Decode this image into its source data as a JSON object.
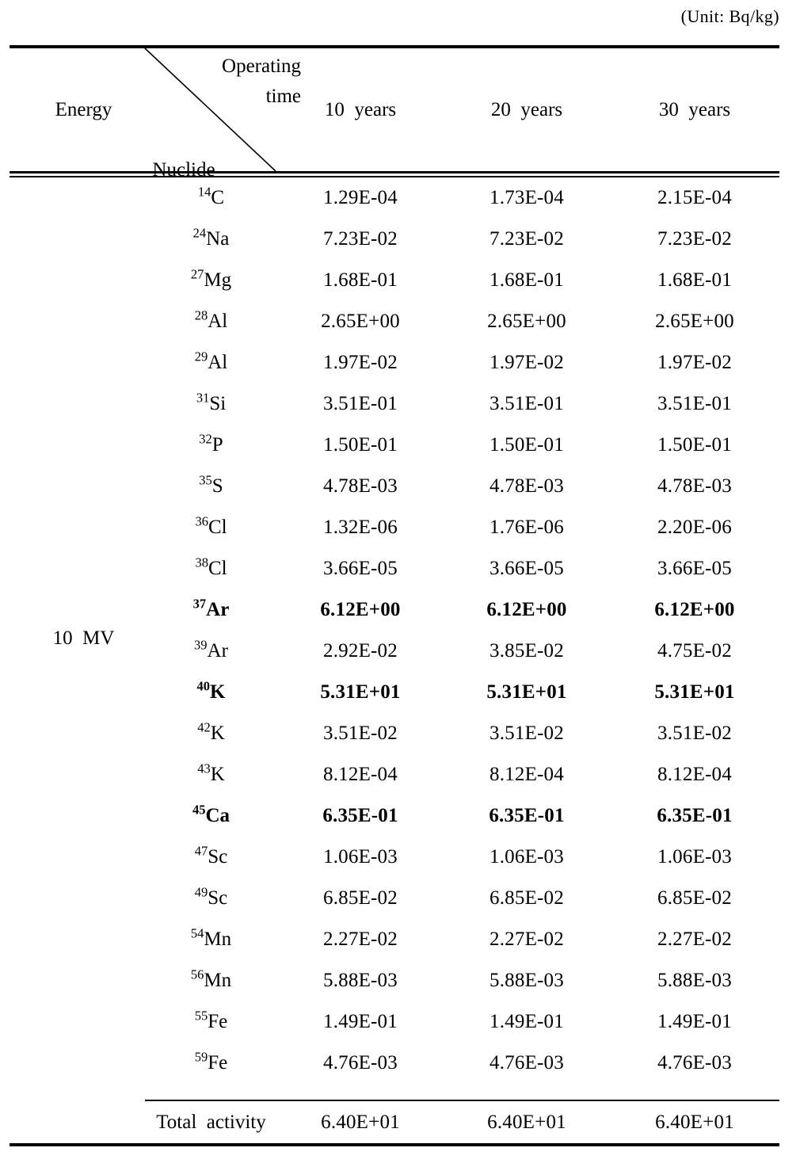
{
  "unit_note": "(Unit:  Bq/kg)",
  "header": {
    "energy_label": "Energy",
    "operating_line1": "Operating",
    "operating_line2": "time",
    "nuclide_label": "Nuclide",
    "columns": [
      "10  years",
      "20  years",
      "30  years"
    ]
  },
  "energy_value": "10  MV",
  "total": {
    "label": "Total  activity",
    "values": [
      "6.40E+01",
      "6.40E+01",
      "6.40E+01"
    ]
  },
  "rows": [
    {
      "mass": "14",
      "element": "C",
      "bold": false,
      "values": [
        "1.29E-04",
        "1.73E-04",
        "2.15E-04"
      ]
    },
    {
      "mass": "24",
      "element": "Na",
      "bold": false,
      "values": [
        "7.23E-02",
        "7.23E-02",
        "7.23E-02"
      ]
    },
    {
      "mass": "27",
      "element": "Mg",
      "bold": false,
      "values": [
        "1.68E-01",
        "1.68E-01",
        "1.68E-01"
      ]
    },
    {
      "mass": "28",
      "element": "Al",
      "bold": false,
      "values": [
        "2.65E+00",
        "2.65E+00",
        "2.65E+00"
      ]
    },
    {
      "mass": "29",
      "element": "Al",
      "bold": false,
      "values": [
        "1.97E-02",
        "1.97E-02",
        "1.97E-02"
      ]
    },
    {
      "mass": "31",
      "element": "Si",
      "bold": false,
      "values": [
        "3.51E-01",
        "3.51E-01",
        "3.51E-01"
      ]
    },
    {
      "mass": "32",
      "element": "P",
      "bold": false,
      "values": [
        "1.50E-01",
        "1.50E-01",
        "1.50E-01"
      ]
    },
    {
      "mass": "35",
      "element": "S",
      "bold": false,
      "values": [
        "4.78E-03",
        "4.78E-03",
        "4.78E-03"
      ]
    },
    {
      "mass": "36",
      "element": "Cl",
      "bold": false,
      "values": [
        "1.32E-06",
        "1.76E-06",
        "2.20E-06"
      ]
    },
    {
      "mass": "38",
      "element": "Cl",
      "bold": false,
      "values": [
        "3.66E-05",
        "3.66E-05",
        "3.66E-05"
      ]
    },
    {
      "mass": "37",
      "element": "Ar",
      "bold": true,
      "values": [
        "6.12E+00",
        "6.12E+00",
        "6.12E+00"
      ]
    },
    {
      "mass": "39",
      "element": "Ar",
      "bold": false,
      "values": [
        "2.92E-02",
        "3.85E-02",
        "4.75E-02"
      ]
    },
    {
      "mass": "40",
      "element": "K",
      "bold": true,
      "values": [
        "5.31E+01",
        "5.31E+01",
        "5.31E+01"
      ]
    },
    {
      "mass": "42",
      "element": "K",
      "bold": false,
      "values": [
        "3.51E-02",
        "3.51E-02",
        "3.51E-02"
      ]
    },
    {
      "mass": "43",
      "element": "K",
      "bold": false,
      "values": [
        "8.12E-04",
        "8.12E-04",
        "8.12E-04"
      ]
    },
    {
      "mass": "45",
      "element": "Ca",
      "bold": true,
      "values": [
        "6.35E-01",
        "6.35E-01",
        "6.35E-01"
      ]
    },
    {
      "mass": "47",
      "element": "Sc",
      "bold": false,
      "values": [
        "1.06E-03",
        "1.06E-03",
        "1.06E-03"
      ]
    },
    {
      "mass": "49",
      "element": "Sc",
      "bold": false,
      "values": [
        "6.85E-02",
        "6.85E-02",
        "6.85E-02"
      ]
    },
    {
      "mass": "54",
      "element": "Mn",
      "bold": false,
      "values": [
        "2.27E-02",
        "2.27E-02",
        "2.27E-02"
      ]
    },
    {
      "mass": "56",
      "element": "Mn",
      "bold": false,
      "values": [
        "5.88E-03",
        "5.88E-03",
        "5.88E-03"
      ]
    },
    {
      "mass": "55",
      "element": "Fe",
      "bold": false,
      "values": [
        "1.49E-01",
        "1.49E-01",
        "1.49E-01"
      ]
    },
    {
      "mass": "59",
      "element": "Fe",
      "bold": false,
      "values": [
        "4.76E-03",
        "4.76E-03",
        "4.76E-03"
      ]
    }
  ]
}
